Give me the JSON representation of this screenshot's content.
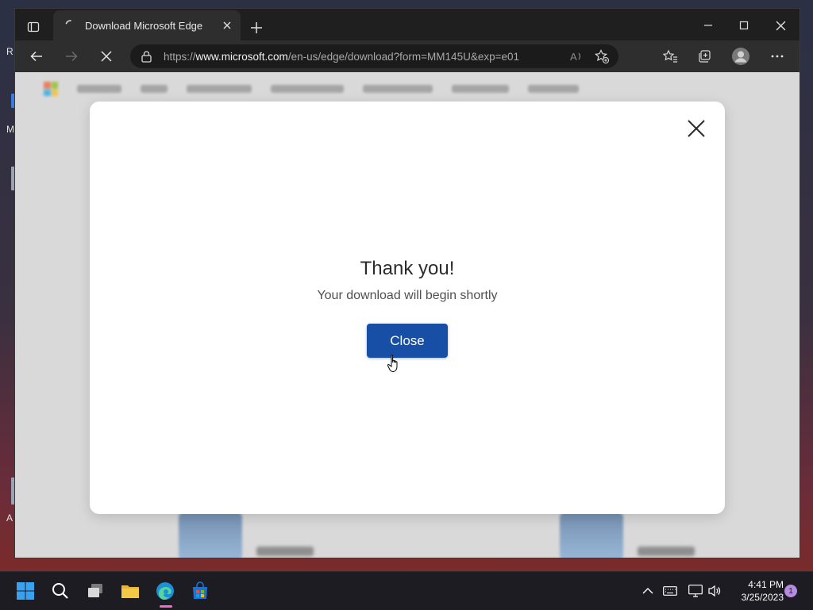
{
  "desktop": {
    "left_labels": [
      "R",
      "M",
      "A"
    ]
  },
  "browser": {
    "tab": {
      "title": "Download Microsoft Edge"
    },
    "address_bar": {
      "url_prefix": "https://",
      "url_domain": "www.microsoft.com",
      "url_path": "/en-us/edge/download?form=MM145U&exp=e01"
    },
    "icons": {
      "tab_actions": "tab-actions-icon",
      "back": "back-arrow-icon",
      "forward": "forward-arrow-icon",
      "stop": "stop-loading-icon",
      "lock": "lock-icon",
      "read_aloud": "read-aloud-icon",
      "add_favorite": "add-favorite-icon",
      "favorites": "favorites-icon",
      "collections": "collections-icon",
      "profile": "profile-icon",
      "more": "more-icon"
    }
  },
  "modal": {
    "title": "Thank you!",
    "subtitle": "Your download will begin shortly",
    "close_button_label": "Close",
    "accent_color": "#174ea6"
  },
  "taskbar": {
    "apps": [
      "start-icon",
      "search-icon",
      "task-view-icon",
      "file-explorer-icon",
      "edge-icon",
      "microsoft-store-icon"
    ],
    "active_app": "edge-icon",
    "clock_time": "4:41 PM",
    "clock_date": "3/25/2023",
    "notification_count": "1"
  }
}
